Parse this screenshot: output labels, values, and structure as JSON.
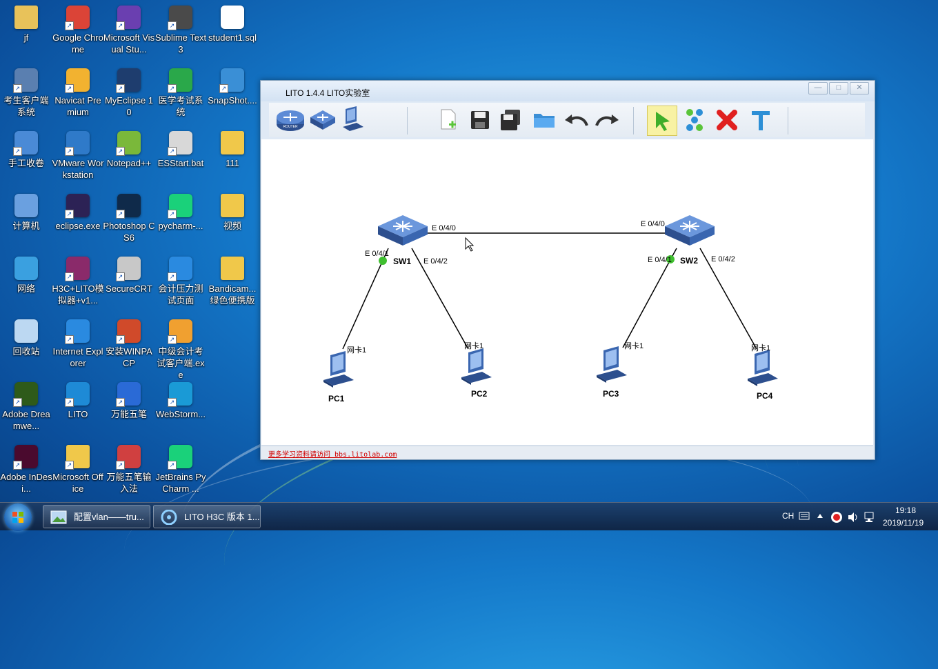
{
  "desktop_icons": [
    {
      "label": "jf",
      "icon": "user-folder-icon"
    },
    {
      "label": "Google Chrome",
      "icon": "chrome-icon"
    },
    {
      "label": "Microsoft Visual Stu...",
      "icon": "visual-studio-icon"
    },
    {
      "label": "Sublime Text 3",
      "icon": "sublime-icon"
    },
    {
      "label": "student1.sql",
      "icon": "file-icon"
    },
    {
      "label": "考生客户端系统",
      "icon": "client-icon"
    },
    {
      "label": "Navicat Premium",
      "icon": "navicat-icon"
    },
    {
      "label": "MyEclipse 10",
      "icon": "myeclipse-icon"
    },
    {
      "label": "医学考试系统",
      "icon": "medical-exam-icon"
    },
    {
      "label": "SnapShot....",
      "icon": "snapshot-icon"
    },
    {
      "label": "手工收卷",
      "icon": "collect-icon"
    },
    {
      "label": "VMware Workstation",
      "icon": "vmware-icon"
    },
    {
      "label": "Notepad++",
      "icon": "notepad-icon"
    },
    {
      "label": "ESStart.bat",
      "icon": "bat-icon"
    },
    {
      "label": "111",
      "icon": "folder-icon"
    },
    {
      "label": "计算机",
      "icon": "computer-icon"
    },
    {
      "label": "eclipse.exe",
      "icon": "eclipse-icon"
    },
    {
      "label": "Photoshop CS6",
      "icon": "photoshop-icon"
    },
    {
      "label": "pycharm-...",
      "icon": "pycharm-icon"
    },
    {
      "label": "视频",
      "icon": "folder-icon"
    },
    {
      "label": "网络",
      "icon": "network-icon"
    },
    {
      "label": "H3C+LITO模拟器+v1...",
      "icon": "winrar-icon"
    },
    {
      "label": "SecureCRT",
      "icon": "securecrt-icon"
    },
    {
      "label": "会计压力测试页面",
      "icon": "ie-icon"
    },
    {
      "label": "Bandicam...绿色便携版",
      "icon": "folder-icon"
    },
    {
      "label": "回收站",
      "icon": "recycle-bin-icon"
    },
    {
      "label": "Internet Explorer",
      "icon": "ie-icon"
    },
    {
      "label": "安装WINPACP",
      "icon": "installer-icon"
    },
    {
      "label": "中级会计考试客户端.exe",
      "icon": "exam-client-icon"
    },
    {
      "label": "Adobe Dreamwe...",
      "icon": "dreamweaver-icon"
    },
    {
      "label": "LITO",
      "icon": "lito-icon"
    },
    {
      "label": "万能五笔",
      "icon": "wubi-icon"
    },
    {
      "label": "WebStorm...",
      "icon": "webstorm-icon"
    },
    {
      "label": "Adobe InDesi...",
      "icon": "indesign-icon"
    },
    {
      "label": "Microsoft Office",
      "icon": "office-folder-icon"
    },
    {
      "label": "万能五笔输入法",
      "icon": "wubi-input-icon"
    },
    {
      "label": "JetBrains PyCharm ...",
      "icon": "pycharm-icon"
    }
  ],
  "window": {
    "title": "LITO 1.4.4  LITO实验室",
    "buttons": {
      "minimize": "—",
      "maximize": "□",
      "close": "✕"
    },
    "toolbar": [
      "router-tool",
      "switch-tool",
      "pc-tool",
      "new-file",
      "save",
      "save-as",
      "open-folder",
      "undo",
      "redo",
      "select-pointer",
      "connect",
      "delete",
      "text"
    ],
    "status_link": "更多学习资料请访问 bbs.litolab.com"
  },
  "topology": {
    "switches": [
      {
        "name": "SW1"
      },
      {
        "name": "SW2"
      }
    ],
    "pcs": [
      {
        "name": "PC1"
      },
      {
        "name": "PC2"
      },
      {
        "name": "PC3"
      },
      {
        "name": "PC4"
      }
    ],
    "ports": {
      "sw1_e040": "E 0/4/0",
      "sw1_e041": "E 0/4/1",
      "sw1_e042": "E 0/4/2",
      "sw2_e040": "E 0/4/0",
      "sw2_e041": "E 0/4/1",
      "sw2_e042": "E 0/4/2",
      "pc1_nic": "网卡1",
      "pc2_nic": "网卡1",
      "pc3_nic": "网卡1",
      "pc4_nic": "网卡1"
    },
    "device_text": {
      "switch": "SWITCH",
      "router": "ROUTER"
    },
    "status_color": "#3fbf2f"
  },
  "taskbar": {
    "items": [
      {
        "label": "配置vlan——tru...",
        "icon": "image-viewer-icon"
      },
      {
        "label": "LITO H3C 版本 1...",
        "icon": "lito-icon"
      }
    ],
    "tray": {
      "lang": "CH",
      "time": "19:18",
      "date": "2019/11/19"
    }
  }
}
